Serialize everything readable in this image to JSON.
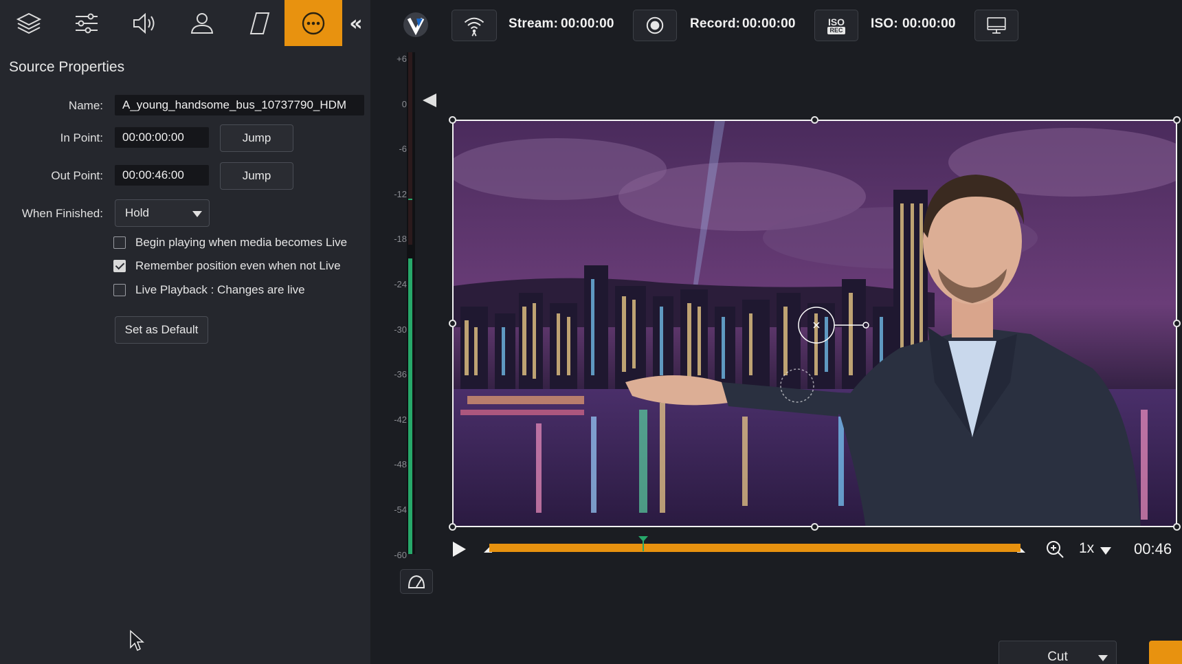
{
  "toolbar": {
    "tools": [
      {
        "name": "layers-icon",
        "active": false
      },
      {
        "name": "sliders-icon",
        "active": false
      },
      {
        "name": "speaker-icon",
        "active": false
      },
      {
        "name": "person-icon",
        "active": false
      },
      {
        "name": "parallelogram-icon",
        "active": false
      },
      {
        "name": "more-options-icon",
        "active": true
      }
    ],
    "collapse_label": "«"
  },
  "source_properties": {
    "title": "Source Properties",
    "name_label": "Name:",
    "name_value": "A_young_handsome_bus_10737790_HDM",
    "in_point_label": "In Point:",
    "in_point_value": "00:00:00:00",
    "out_point_label": "Out Point:",
    "out_point_value": "00:00:46:00",
    "jump_label": "Jump",
    "when_finished_label": "When Finished:",
    "when_finished_value": "Hold",
    "options": [
      {
        "label": "Begin playing when media becomes Live",
        "checked": false
      },
      {
        "label": "Remember position even when not Live",
        "checked": true
      },
      {
        "label": "Live Playback : Changes are live",
        "checked": false
      }
    ],
    "set_default_label": "Set as Default"
  },
  "status_bar": {
    "stream_label": "Stream:",
    "stream_time": "00:00:00",
    "record_label": "Record:",
    "record_time": "00:00:00",
    "iso_label": "ISO:",
    "iso_time": "00:00:00",
    "iso_badge_top": "ISO",
    "iso_badge_bottom": "REC"
  },
  "audio_meter": {
    "ticks": [
      "+6",
      "0",
      "-6",
      "-12",
      "-18",
      "-24",
      "-30",
      "-36",
      "-42",
      "-48",
      "-54",
      "-60"
    ]
  },
  "playback": {
    "speed": "1x",
    "duration": "00:46",
    "progress_fraction": 0.29
  },
  "transition": {
    "selected": "Cut"
  },
  "colors": {
    "accent": "#e8920f",
    "meter_green": "#27a86a"
  }
}
